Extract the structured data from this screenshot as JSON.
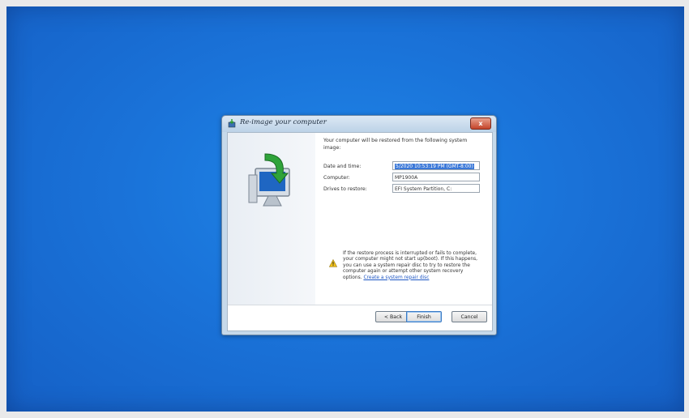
{
  "dialog": {
    "title": "Re-image your computer",
    "close_label": "x",
    "intro": "Your computer will be restored from the following system image:",
    "fields": [
      {
        "label": "Date and time:",
        "value": "5/2020 10:53:19 PM (GMT-8:00)",
        "selected": true
      },
      {
        "label": "Computer:",
        "value": "MP1900A",
        "selected": false
      },
      {
        "label": "Drives to restore:",
        "value": "EFI System Partition, C:",
        "selected": false
      }
    ],
    "warning": {
      "text": "If the restore process is interrupted or fails to complete, your computer might not start up(boot). If this happens, you can use a system repair disc to try to restore the computer again or attempt other system recovery options.",
      "link": "Create a system repair disc"
    },
    "buttons": {
      "back": "< Back",
      "finish": "Finish",
      "cancel": "Cancel"
    }
  },
  "colors": {
    "desktop": "#1a73d9",
    "dialog_frame": "#c6d9ea",
    "selection": "#3a78d8",
    "link": "#1f57c4"
  },
  "icons": {
    "title": "restore-icon",
    "hero": "monitor-restore-arrow-icon",
    "warning": "warning-icon",
    "close": "close-icon"
  }
}
